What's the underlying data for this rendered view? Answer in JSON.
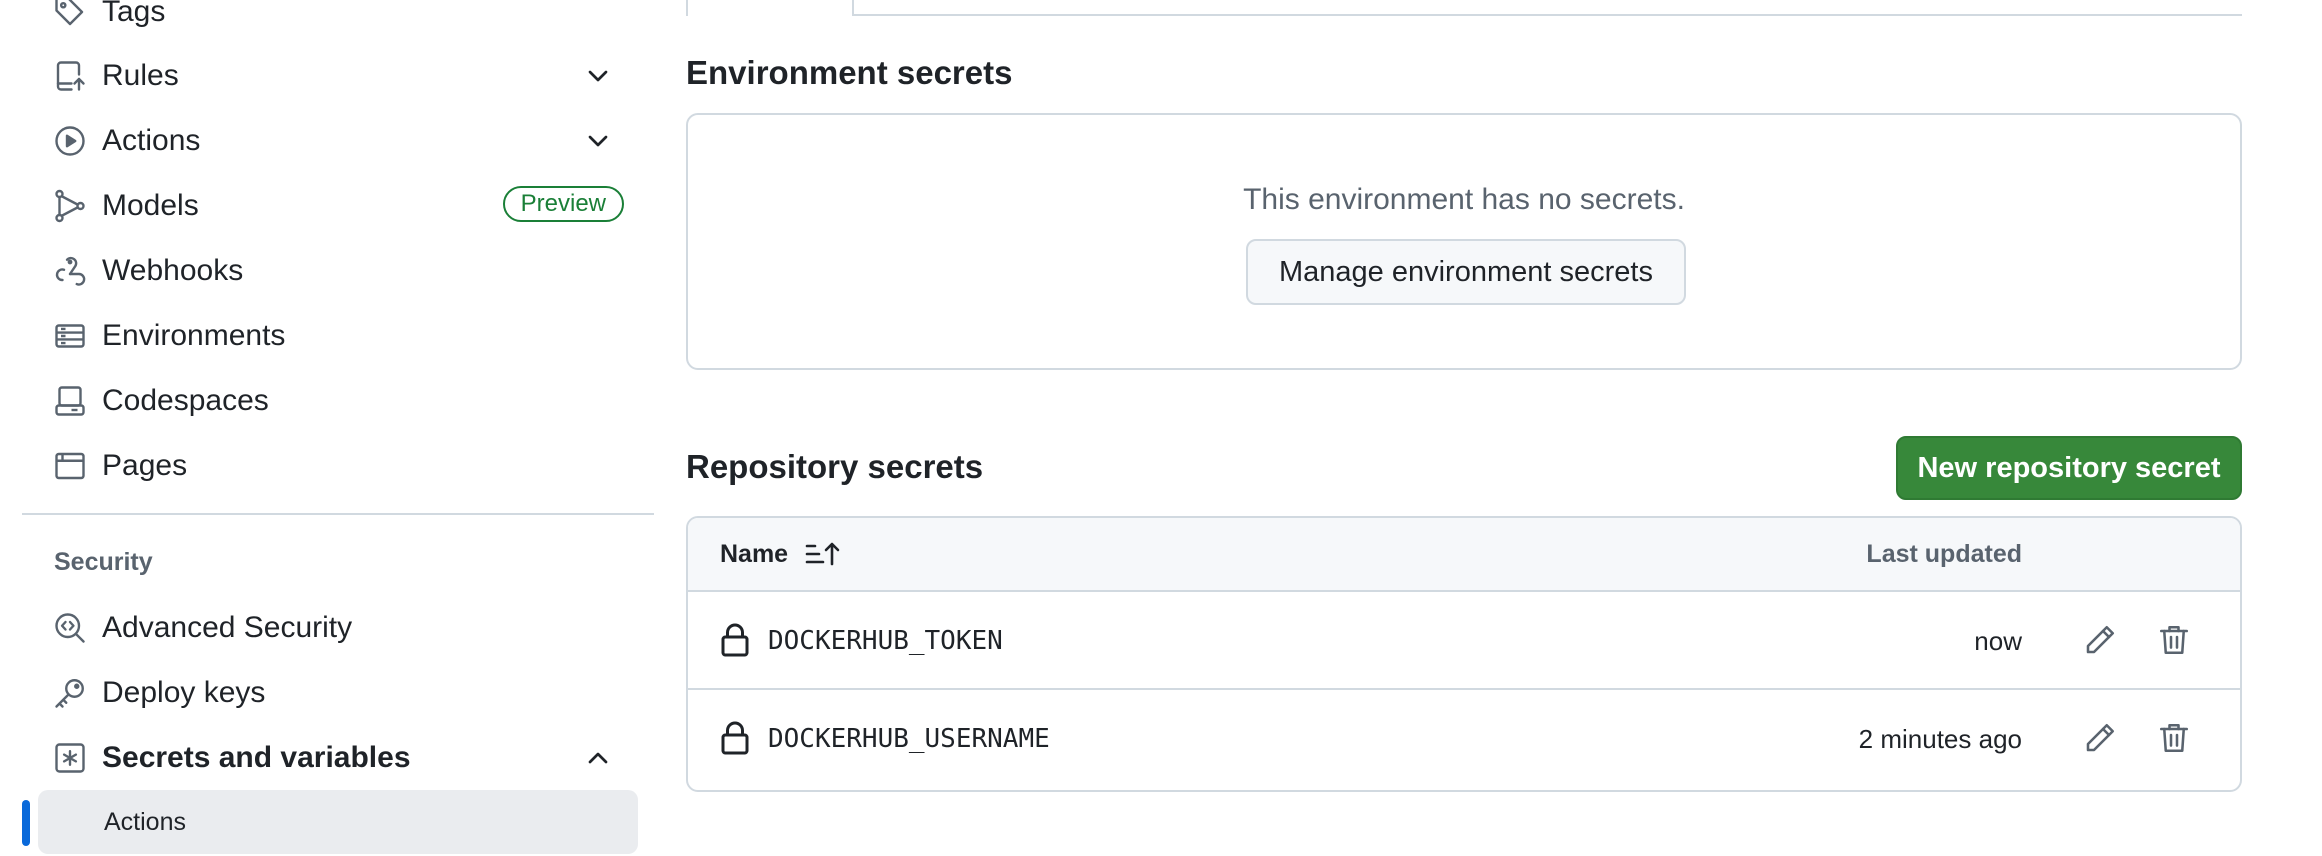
{
  "sidebar": {
    "items": [
      {
        "id": "tags",
        "label": "Tags",
        "icon": "tag-icon"
      },
      {
        "id": "rules",
        "label": "Rules",
        "icon": "rules-icon",
        "expandable": true
      },
      {
        "id": "actions",
        "label": "Actions",
        "icon": "play-circle-icon",
        "expandable": true
      },
      {
        "id": "models",
        "label": "Models",
        "icon": "models-icon",
        "badge": "Preview"
      },
      {
        "id": "webhooks",
        "label": "Webhooks",
        "icon": "webhook-icon"
      },
      {
        "id": "environments",
        "label": "Environments",
        "icon": "server-icon"
      },
      {
        "id": "codespaces",
        "label": "Codespaces",
        "icon": "codespaces-icon"
      },
      {
        "id": "pages",
        "label": "Pages",
        "icon": "browser-icon"
      }
    ],
    "security_section": {
      "title": "Security",
      "items": [
        {
          "id": "advanced-security",
          "label": "Advanced Security",
          "icon": "codescan-icon"
        },
        {
          "id": "deploy-keys",
          "label": "Deploy keys",
          "icon": "key-icon"
        },
        {
          "id": "secrets-and-variables",
          "label": "Secrets and variables",
          "icon": "asterisk-icon",
          "expanded": true
        }
      ],
      "active_subitem": "Actions"
    }
  },
  "environment_secrets": {
    "title": "Environment secrets",
    "empty_message": "This environment has no secrets.",
    "manage_button": "Manage environment secrets"
  },
  "repository_secrets": {
    "title": "Repository secrets",
    "new_button": "New repository secret",
    "columns": {
      "name": "Name",
      "last_updated": "Last updated"
    },
    "rows": [
      {
        "name": "DOCKERHUB_TOKEN",
        "updated": "now"
      },
      {
        "name": "DOCKERHUB_USERNAME",
        "updated": "2 minutes ago"
      }
    ]
  },
  "colors": {
    "accent_blue": "#0969da",
    "success_green": "#37883a",
    "preview_badge": "#1a7f37"
  }
}
